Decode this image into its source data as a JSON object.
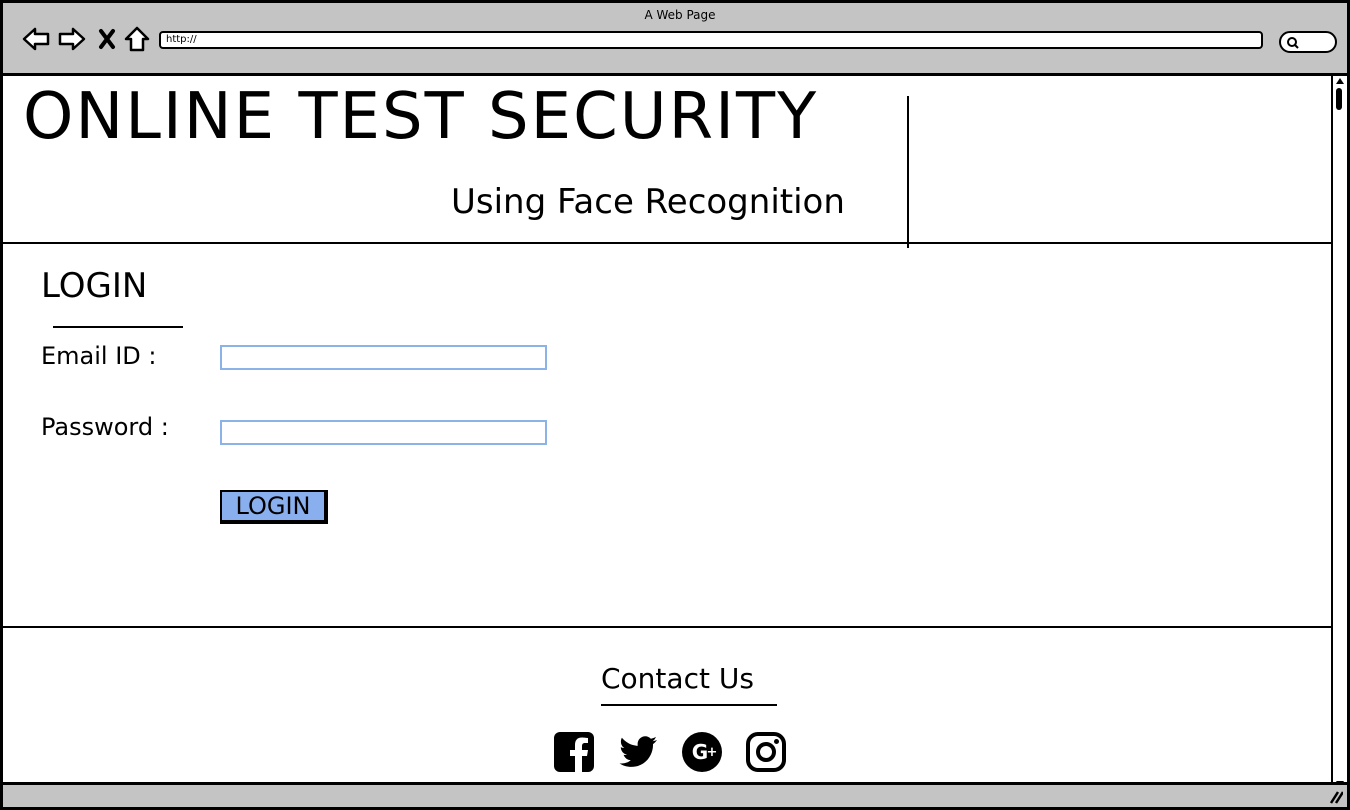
{
  "window": {
    "title": "A Web Page"
  },
  "browser": {
    "url": "http://",
    "icons": [
      "back-icon",
      "forward-icon",
      "close-icon",
      "home-icon",
      "search-icon"
    ]
  },
  "header": {
    "title": "ONLINE TEST SECURITY",
    "subtitle": "Using Face Recognition"
  },
  "login": {
    "heading": "LOGIN",
    "email_label": "Email ID :",
    "email_value": "",
    "password_label": "Password :",
    "password_value": "",
    "button_label": "LOGIN"
  },
  "footer": {
    "contact_label": "Contact Us",
    "social_icons": [
      "facebook-icon",
      "twitter-icon",
      "google-plus-icon",
      "instagram-icon"
    ]
  },
  "colors": {
    "chrome": "#c4c4c4",
    "input_border": "#8cb3e8",
    "button": "#89afee"
  }
}
